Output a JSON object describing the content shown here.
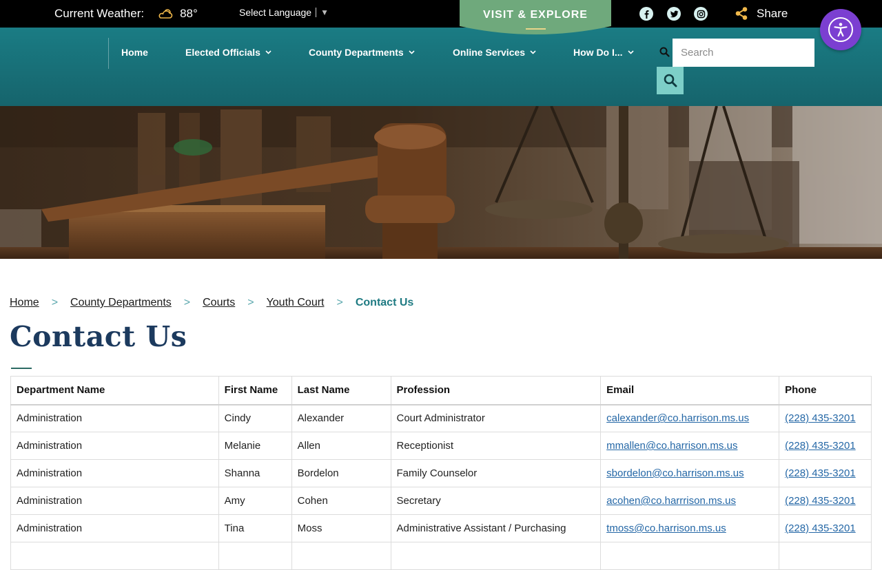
{
  "topbar": {
    "weather_label": "Current Weather:",
    "weather_icon": "partly-cloudy-icon",
    "temperature": "88°",
    "language_label": "Select Language",
    "language_caret": "▼",
    "visit_label": "VISIT & EXPLORE",
    "share_label": "Share",
    "social_icons": [
      "facebook-icon",
      "twitter-icon",
      "instagram-icon"
    ]
  },
  "nav": {
    "items": [
      {
        "label": "Home",
        "has_dropdown": false
      },
      {
        "label": "Elected Officials",
        "has_dropdown": true
      },
      {
        "label": "County Departments",
        "has_dropdown": true
      },
      {
        "label": "Online Services",
        "has_dropdown": true
      },
      {
        "label": "How Do I...",
        "has_dropdown": true
      }
    ],
    "search_placeholder": "Search"
  },
  "breadcrumb": {
    "items": [
      "Home",
      "County Departments",
      "Courts",
      "Youth Court"
    ],
    "current": "Contact Us",
    "separator": ">"
  },
  "page_title": "Contact Us",
  "table": {
    "headers": [
      "Department Name",
      "First Name",
      "Last Name",
      "Profession",
      "Email",
      "Phone"
    ],
    "rows": [
      [
        "Administration",
        "Cindy",
        "Alexander",
        "Court Administrator",
        "calexander@co.harrison.ms.us",
        "(228) 435-3201"
      ],
      [
        "Administration",
        "Melanie",
        "Allen",
        "Receptionist",
        "mmallen@co.harrison.ms.us",
        "(228) 435-3201"
      ],
      [
        "Administration",
        "Shanna",
        "Bordelon",
        "Family Counselor",
        "sbordelon@co.harrison.ms.us",
        "(228) 435-3201"
      ],
      [
        "Administration",
        "Amy",
        "Cohen",
        "Secretary",
        "acohen@co.harrrison.ms.us",
        "(228) 435-3201"
      ],
      [
        "Administration",
        "Tina",
        "Moss",
        "Administrative Assistant / Purchasing",
        "tmoss@co.harrison.ms.us",
        "(228) 435-3201"
      ],
      [
        "",
        "",
        "",
        "",
        "",
        ""
      ]
    ]
  },
  "colors": {
    "topbar_bg": "#000000",
    "nav_bg": "#1a7c84",
    "visit_tab": "#6fa97c",
    "title": "#1c3a5e",
    "accent": "#1e7a82",
    "link": "#2467a6",
    "accessibility": "#7b3fd1"
  }
}
